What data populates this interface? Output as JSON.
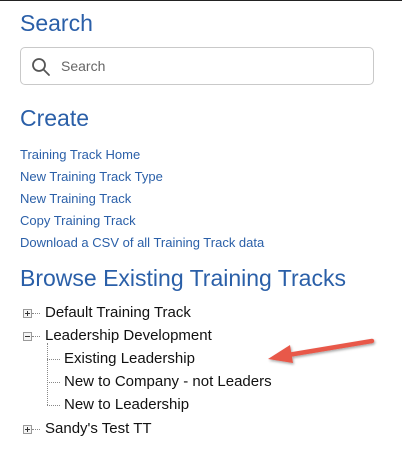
{
  "search": {
    "title": "Search",
    "placeholder": "Search",
    "icon": "search-icon"
  },
  "create": {
    "title": "Create",
    "links": [
      "Training Track Home",
      "New Training Track Type",
      "New Training Track",
      "Copy Training Track",
      "Download a CSV of all Training Track data"
    ]
  },
  "browse": {
    "title": "Browse Existing Training Tracks",
    "tree": [
      {
        "label": "Default Training Track",
        "expanded": false
      },
      {
        "label": "Leadership Development",
        "expanded": true,
        "children": [
          "Existing Leadership",
          "New to Company - not Leaders",
          "New to Leadership"
        ]
      },
      {
        "label": "Sandy's Test TT",
        "expanded": false
      }
    ]
  },
  "colors": {
    "heading": "#2a5fa8",
    "link": "#2a5fa8",
    "annotation_arrow": "#e8584a"
  },
  "annotation": {
    "type": "arrow",
    "points_to": "Existing Leadership"
  }
}
